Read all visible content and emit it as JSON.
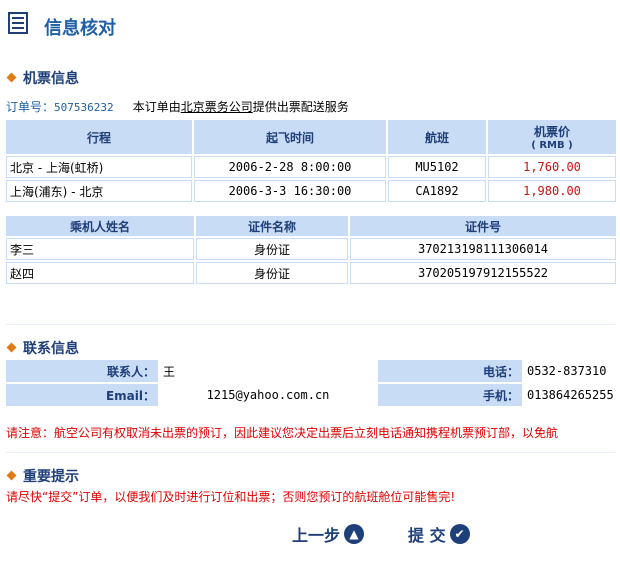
{
  "page": {
    "title": "信息核对"
  },
  "ticket_section": {
    "title": "机票信息",
    "order_label": "订单号：",
    "order_no": "507536232",
    "notice_prefix": "本订单由",
    "company": "北京票务公司",
    "notice_suffix": "提供出票配送服务",
    "flight_headers": [
      "行程",
      "起飞时间",
      "航班",
      "机票价",
      "( RMB )"
    ],
    "flights": [
      {
        "route": "北京 - 上海(虹桥)",
        "time": "2006-2-28 8:00:00",
        "flight": "MU5102",
        "price": "1,760.00"
      },
      {
        "route": "上海(浦东) - 北京",
        "time": "2006-3-3 16:30:00",
        "flight": "CA1892",
        "price": "1,980.00"
      }
    ],
    "passenger_headers": [
      "乘机人姓名",
      "证件名称",
      "证件号"
    ],
    "passengers": [
      {
        "name": "李三",
        "doc_type": "身份证",
        "doc_no": "370213198111306014"
      },
      {
        "name": "赵四",
        "doc_type": "身份证",
        "doc_no": "370205197912155522"
      }
    ]
  },
  "contact_section": {
    "title": "联系信息",
    "contact_label": "联系人：",
    "contact_value": "王",
    "phone_label": "电话：",
    "phone_value": "0532-837310",
    "email_label": "Email：",
    "email_value": "1215@yahoo.com.cn",
    "mobile_label": "手机：",
    "mobile_value": "013864265255"
  },
  "warning": "请注意：航空公司有权取消未出票的预订，因此建议您决定出票后立刻电话通知携程机票预订部，以免航",
  "tips_section": {
    "title": "重要提示",
    "text": "请尽快“提交”订单，以便我们及时进行订位和出票；否则您预订的航班舱位可能售完!"
  },
  "buttons": {
    "prev": "上一步",
    "submit": "提 交"
  },
  "colors": {
    "accent": "#1f5fa8",
    "header_bg": "#c9dcf5",
    "warning": "#e00000",
    "diamond": "#e07a12"
  }
}
